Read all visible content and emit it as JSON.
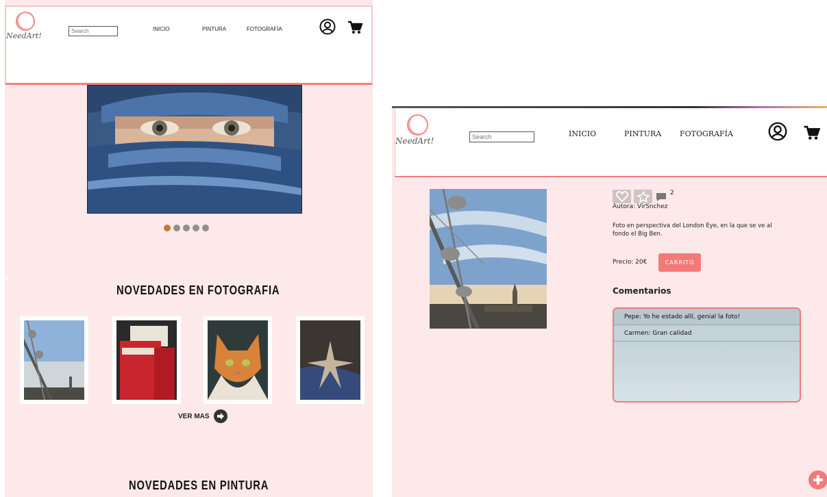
{
  "brand": {
    "logo_text": "NeedArt!"
  },
  "search": {
    "placeholder": "Search"
  },
  "nav": {
    "inicio": "INICIO",
    "pintura": "PINTURA",
    "fotografia": "FOTOGRAFÍA"
  },
  "home": {
    "section_foto": "NOVEDADES EN FOTOGRAFIA",
    "ver_mas": "VER MAS",
    "section_pintura": "NOVEDADES EN PINTURA",
    "prev_arrow": "‹"
  },
  "detail": {
    "comment_count": "2",
    "author": "Autora: VirSnchez",
    "description": "Foto en perspectiva del London Eye, en la que se ve al fondo el Big Ben.",
    "price": "Precio: 20€",
    "cart_button": "CARRITO",
    "comments_title": "Comentarios",
    "comments": [
      "Pepe: Yo he estado allí, genial la foto!",
      "Carmen: Gran calidad"
    ],
    "add_icon": "plus-icon"
  },
  "colors": {
    "accent": "#f47a7a",
    "page_bg": "#fde9e9",
    "active_dot": "#c5783c"
  }
}
